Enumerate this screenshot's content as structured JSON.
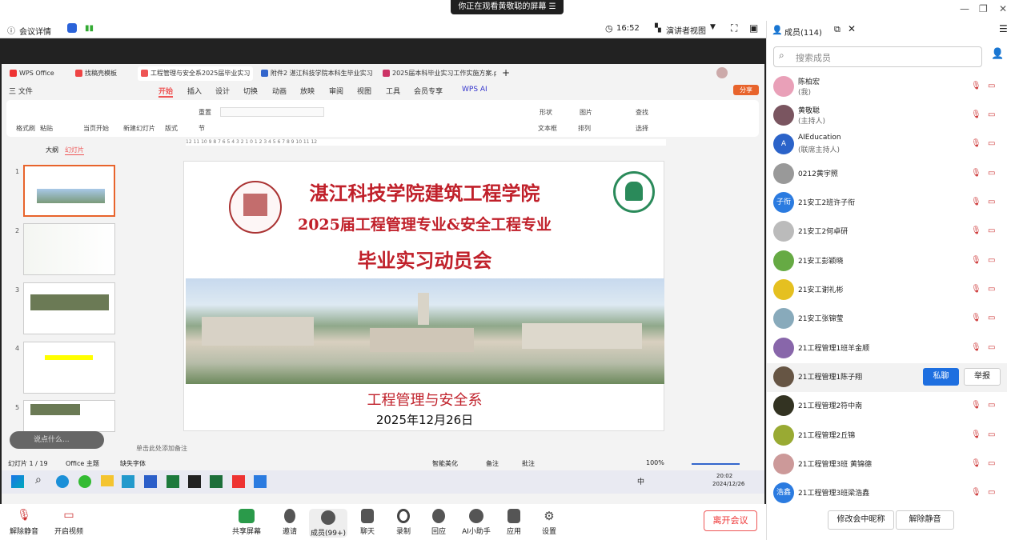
{
  "window": {
    "banner": "你正在观看黄敬聪的屏幕",
    "banner_icon": "menu-icon"
  },
  "toolbar": {
    "meeting_info": "会议详情",
    "time": "16:52",
    "view": "演讲者视图"
  },
  "wps": {
    "tabs": [
      "WPS Office",
      "找稿壳模板",
      "工程管理与安全系2025届毕业实习",
      "附件2 湛江科技学院本科生毕业实习",
      "2025届本科毕业实习工作实施方案.pd"
    ],
    "menus": [
      "三 文件",
      "开始",
      "插入",
      "设计",
      "切换",
      "动画",
      "放映",
      "审阅",
      "视图",
      "工具",
      "会员专享",
      "WPS AI"
    ],
    "share": "分享",
    "ribbon": [
      "格式刷",
      "粘贴",
      "当页开始",
      "新建幻灯片",
      "版式",
      "重置",
      "节",
      "形状",
      "图片",
      "查找",
      "文本框",
      "排列",
      "选择"
    ],
    "panel_tabs": [
      "大纲",
      "幻灯片"
    ],
    "thumb_numbers": [
      "1",
      "2",
      "3",
      "4",
      "5"
    ],
    "notes": "单击此处添加备注",
    "ask": "说点什么...",
    "status": {
      "slide": "幻灯片 1 / 19",
      "theme": "Office 主题",
      "font": "缺失字体",
      "beautify": "智能美化",
      "notes": "备注",
      "comments": "批注",
      "zoom": "100%"
    },
    "ruler": "12 11 10 9 8 7 6 5 4 3 2 1 0 1 2 3 4 5 6 7 8 9 10 11 12"
  },
  "slide": {
    "title1": "湛江科技学院建筑工程学院",
    "title2": "2025届工程管理专业&安全工程专业",
    "title3": "毕业实习动员会",
    "dept": "工程管理与安全系",
    "date": "2025年12月26日",
    "logo_left_text": "湛江科技学院"
  },
  "taskbar": {
    "time": "20:02",
    "date": "2024/12/26",
    "ime": "中"
  },
  "bottom": {
    "buttons": [
      "解除静音",
      "开启视频",
      "共享屏幕",
      "邀请",
      "成员(99+)",
      "聊天",
      "录制",
      "回应",
      "AI小助手",
      "应用",
      "设置"
    ],
    "leave": "离开会议"
  },
  "panel": {
    "title": "成员(114)",
    "search_placeholder": "搜索成员",
    "members": [
      {
        "name": "陈柏宏",
        "sub": "(我)",
        "color": "#e9a0b8"
      },
      {
        "name": "黄敬聪",
        "sub": "(主持人)",
        "color": "#7a5560"
      },
      {
        "name": "AIEducation",
        "sub": "(联席主持人)",
        "color": "#2b63c9",
        "initial": "A"
      },
      {
        "name": "0212黄宇照",
        "color": "#999"
      },
      {
        "name": "21安工2班许子衔",
        "color": "#2b7be0",
        "initial": "子衔"
      },
      {
        "name": "21安工2何卓研",
        "color": "#bbb"
      },
      {
        "name": "21安工彭颖晓",
        "color": "#6a4"
      },
      {
        "name": "21安工谢礼彬",
        "color": "#e5c020"
      },
      {
        "name": "21安工张锦莹",
        "color": "#8ab"
      },
      {
        "name": "21工程管理1班羊金顺",
        "color": "#86a"
      },
      {
        "name": "21工程管理1陈子翔",
        "color": "#654"
      },
      {
        "name": "21工程管理2符中南",
        "color": "#332"
      },
      {
        "name": "21工程管理2丘锦",
        "color": "#9a3"
      },
      {
        "name": "21工程管理3班 黄锦德",
        "color": "#c99"
      },
      {
        "name": "21工程管理3班梁浩鑫",
        "color": "#2b7be0",
        "initial": "浩鑫"
      }
    ],
    "private_chat": "私聊",
    "report": "举报",
    "rename": "修改会中昵称",
    "unmute_all": "解除静音"
  }
}
